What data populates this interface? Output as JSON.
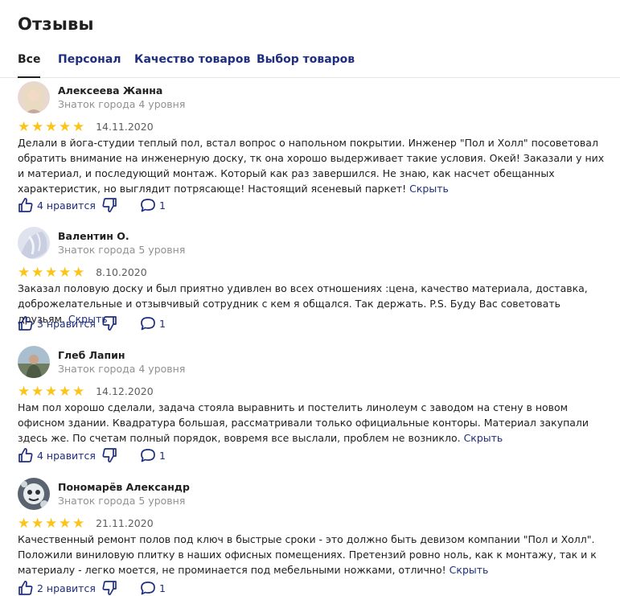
{
  "page": {
    "title": "Отзывы"
  },
  "tabs": [
    {
      "label": "Все",
      "active": true
    },
    {
      "label": "Персонал",
      "active": false
    },
    {
      "label": "Качество товаров",
      "active": false
    },
    {
      "label": "Выбор товаров",
      "active": false
    }
  ],
  "reviews": [
    {
      "name": "Алексеева Жанна",
      "level": "Знаток города 4 уровня",
      "stars": 5,
      "date": "14.11.2020",
      "text": "Делали в йога-студии теплый пол, встал вопрос о напольном покрытии. Инженер \"Пол и Холл\" посоветовал обратить внимание на инженерную доску, тк она хорошо выдерживает такие условия. Окей! Заказали у них и материал, и последующий монтаж. Который как раз завершился. Не знаю, как насчет обещанных характеристик, но выглядит потрясающе! Настоящий ясеневый паркет!",
      "hide_label": "Скрыть",
      "likes_label": "4 нравится",
      "comments_count": "1"
    },
    {
      "name": "Валентин О.",
      "level": "Знаток города 5 уровня",
      "stars": 5,
      "date": "8.10.2020",
      "text": "Заказал половую доску и был приятно удивлен во всех отношениях :цена, качество материала, доставка, доброжелательные и отзывчивый сотрудник с кем я общался. Так держать. P.S. Буду Вас советовать друзьям.",
      "hide_label": "Скрыть",
      "likes_label": "3 нравится",
      "comments_count": "1"
    },
    {
      "name": "Глеб Лапин",
      "level": "Знаток города 4 уровня",
      "stars": 5,
      "date": "14.12.2020",
      "text": "Нам пол хорошо сделали, задача стояла выравнить и постелить линолеум с заводом на стену в новом офисном здании. Квадратура большая, рассматривали только официальные конторы. Материал закупали здесь же. По счетам полный порядок, вовремя все выслали, проблем не возникло.",
      "hide_label": "Скрыть",
      "likes_label": "4 нравится",
      "comments_count": "1"
    },
    {
      "name": "Пономарёв Александр",
      "level": "Знаток города 5 уровня",
      "stars": 5,
      "date": "21.11.2020",
      "text": "Качественный ремонт полов под ключ в быстрые сроки - это должно быть девизом компании \"Пол и Холл\". Положили виниловую плитку в наших офисных помещениях. Претензий ровно ноль, как к монтажу, так и к материалу - легко моется, не проминается под мебельными ножками, отлично!",
      "hide_label": "Скрыть",
      "likes_label": "2 нравится",
      "comments_count": "1"
    }
  ],
  "icons": {
    "star": "star-icon",
    "like": "thumbs-up-icon",
    "dislike": "thumbs-down-icon",
    "comment": "comment-icon"
  },
  "colors": {
    "link": "#1f2e7d",
    "star": "#fcc419",
    "muted": "#919191"
  }
}
